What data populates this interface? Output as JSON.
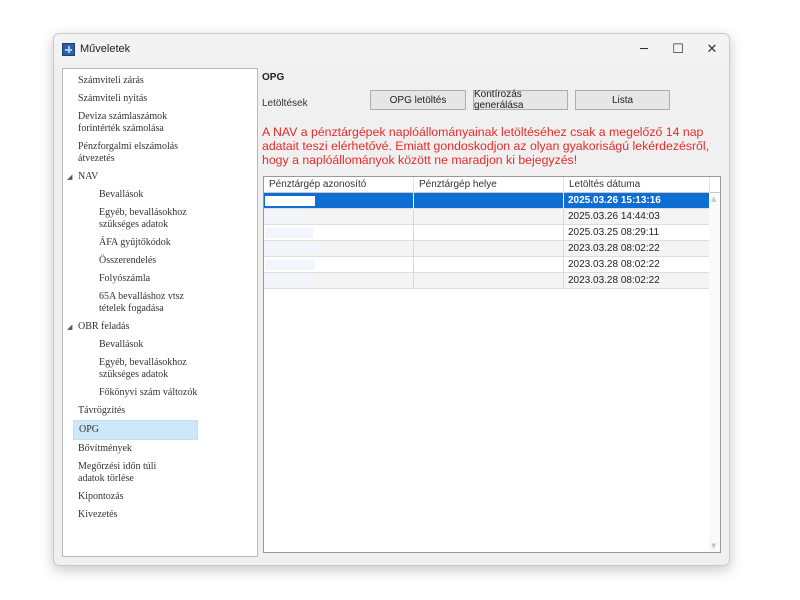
{
  "window": {
    "title": "Műveletek",
    "controls": {
      "minimize": "─",
      "maximize": "☐",
      "close": "✕"
    }
  },
  "sidebar": {
    "items": [
      {
        "label": "Számviteli zárás",
        "level": 0
      },
      {
        "label": "Számviteli nyitás",
        "level": 0
      },
      {
        "label": "Deviza számlaszámok\nforintérték számolása",
        "level": 0
      },
      {
        "label": "Pénzforgalmi elszámolás\nátvezetés",
        "level": 0
      },
      {
        "label": "NAV",
        "level": "group"
      },
      {
        "label": "Bevallások",
        "level": 1
      },
      {
        "label": "Egyéb, bevallásokhoz\nszükséges adatok",
        "level": 1
      },
      {
        "label": "ÁFA gyűjtőkódok",
        "level": 1
      },
      {
        "label": "Összerendelés",
        "level": 1
      },
      {
        "label": "Folyószámla",
        "level": 1
      },
      {
        "label": "65A bevalláshoz vtsz\ntételek fogadása",
        "level": 1
      },
      {
        "label": "OBR feladás",
        "level": "group"
      },
      {
        "label": "Bevallások",
        "level": 1
      },
      {
        "label": "Egyéb, bevallásokhoz\nszükséges adatok",
        "level": 1
      },
      {
        "label": "Főkönyvi szám változók",
        "level": 1
      },
      {
        "label": "Távrögzítés",
        "level": 0
      },
      {
        "label": "OPG",
        "level": 0,
        "selected": true
      },
      {
        "label": "Bővítmények",
        "level": 0
      },
      {
        "label": "Megőrzési időn túli\nadatok törlése",
        "level": 0
      },
      {
        "label": "Kipontozás",
        "level": 0
      },
      {
        "label": "Kivezetés",
        "level": 0
      }
    ]
  },
  "main": {
    "section_title": "OPG",
    "downloads_label": "Letöltések",
    "buttons": {
      "opg_download": "OPG letöltés",
      "posting_generate": "Kontírozás generálása",
      "list": "Lista"
    },
    "warning": "A NAV a pénztárgépek naplóállományainak letöltéséhez csak a megelőző 14 nap adatait teszi elérhetővé. Emiatt gondoskodjon az olyan gyakoriságú lekérdezésről, hogy a naplóállományok között ne maradjon ki bejegyzés!",
    "table": {
      "columns": [
        "Pénztárgép azonosító",
        "Pénztárgép helye",
        "Letöltés dátuma"
      ],
      "rows": [
        {
          "id": "",
          "location": "",
          "date": "2025.03.26 15:13:16",
          "selected": true
        },
        {
          "id": "",
          "location": "",
          "date": "2025.03.26 14:44:03"
        },
        {
          "id": "",
          "location": "",
          "date": "2025.03.25 08:29:11"
        },
        {
          "id": "",
          "location": "",
          "date": "2023.03.28 08:02:22"
        },
        {
          "id": "",
          "location": "",
          "date": "2023.03.28 08:02:22"
        },
        {
          "id": "",
          "location": "",
          "date": "2023.03.28 08:02:22"
        }
      ]
    }
  }
}
